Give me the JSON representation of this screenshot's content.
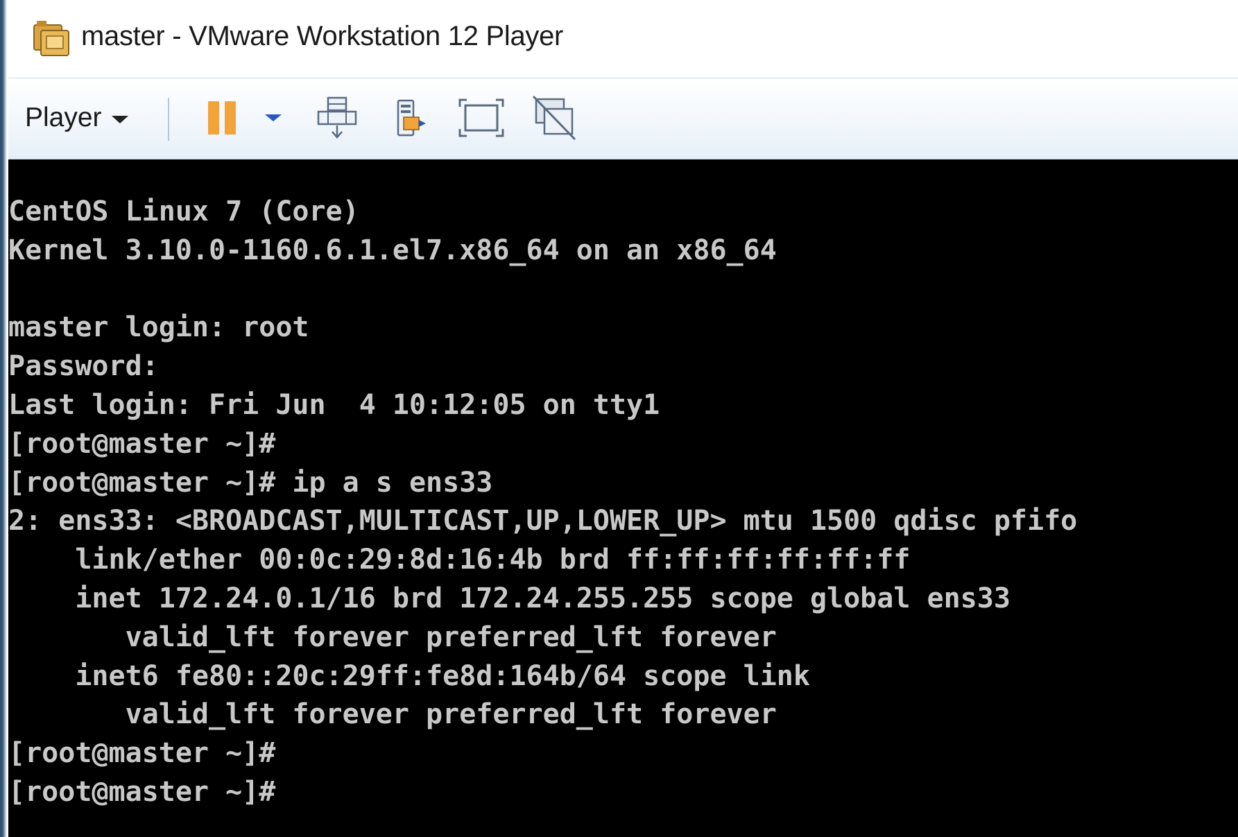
{
  "window": {
    "title": "master - VMware Workstation 12 Player"
  },
  "toolbar": {
    "player_label": "Player",
    "icons": [
      "app-icon",
      "chevron-down-icon",
      "pause-icon",
      "send-ctrl-alt-del-icon",
      "removable-devices-icon",
      "fullscreen-icon",
      "unity-icon"
    ]
  },
  "colors": {
    "console_bg": "#000000",
    "console_fg": "#c8c8c8",
    "pause_accent": "#f2a33a"
  },
  "console": {
    "lines": [
      "CentOS Linux 7 (Core)",
      "Kernel 3.10.0-1160.6.1.el7.x86_64 on an x86_64",
      "",
      "master login: root",
      "Password:",
      "Last login: Fri Jun  4 10:12:05 on tty1",
      "[root@master ~]#",
      "[root@master ~]# ip a s ens33",
      "2: ens33: <BROADCAST,MULTICAST,UP,LOWER_UP> mtu 1500 qdisc pfifo",
      "    link/ether 00:0c:29:8d:16:4b brd ff:ff:ff:ff:ff:ff",
      "    inet 172.24.0.1/16 brd 172.24.255.255 scope global ens33",
      "       valid_lft forever preferred_lft forever",
      "    inet6 fe80::20c:29ff:fe8d:164b/64 scope link",
      "       valid_lft forever preferred_lft forever",
      "[root@master ~]#",
      "[root@master ~]#"
    ]
  }
}
